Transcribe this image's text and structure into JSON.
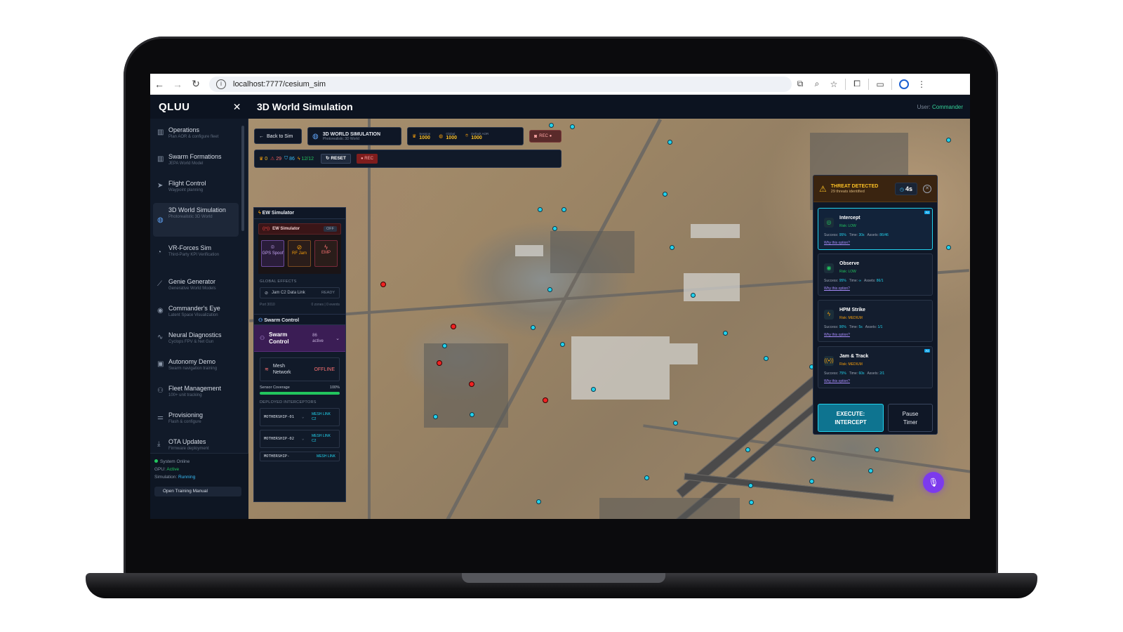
{
  "browser": {
    "url": "localhost:7777/cesium_sim"
  },
  "header": {
    "brand": "QLUU",
    "title": "3D World Simulation",
    "user_label": "User:",
    "user_name": "Commander"
  },
  "sidebar": {
    "items": [
      {
        "title": "Operations",
        "sub": "Plan AOR & configure fleet"
      },
      {
        "title": "Swarm Formations",
        "sub": "JEPA World Model"
      },
      {
        "title": "Flight Control",
        "sub": "Waypoint planning"
      },
      {
        "title": "3D World Simulation",
        "sub": "Photorealistic 3D World"
      },
      {
        "title": "VR-Forces Sim",
        "sub": "Third-Party KPI Verification"
      },
      {
        "title": "Genie Generator",
        "sub": "Generative World Models"
      },
      {
        "title": "Commander's Eye",
        "sub": "Latent Space Visualization"
      },
      {
        "title": "Neural Diagnostics",
        "sub": "Cyclops FPV & Net Gun"
      },
      {
        "title": "Autonomy Demo",
        "sub": "Swarm navigation training"
      },
      {
        "title": "Fleet Management",
        "sub": "100+ unit tracking"
      },
      {
        "title": "Provisioning",
        "sub": "Flash & configure"
      },
      {
        "title": "OTA Updates",
        "sub": "Firmware deployment"
      }
    ],
    "status": {
      "system": "System Online",
      "gpu_label": "GPU:",
      "gpu_value": "Active",
      "sim_label": "Simulation:",
      "sim_value": "Running",
      "manual": "Open Training Manual"
    }
  },
  "toolbar": {
    "back": "Back to Sim",
    "sim_title": "3D WORLD SIMULATION",
    "sim_sub": "Photorealistic 3D World",
    "session_label": "Session",
    "session_value": "1000",
    "global_label": "Global",
    "global_value": "1000",
    "aor_label": "Default AOR",
    "aor_value": "1000",
    "rec_top": "REC ●",
    "stat_trophy": "0",
    "stat_warn": "29",
    "stat_shield": "86",
    "stat_bolt": "12/12",
    "reset": "RESET",
    "rec": "● REC"
  },
  "ew": {
    "header": "EW Simulator",
    "card_label": "EW Simulator",
    "card_state": "OFF",
    "tiles": [
      "GPS Spoof",
      "RF Jam",
      "EMP"
    ],
    "global_effects": "GLOBAL EFFECTS",
    "jam_label": "Jam C2 Data Link",
    "jam_state": "READY",
    "port": "Port 3010",
    "zones": "0 zones | 0 events"
  },
  "swarm": {
    "header": "Swarm Control",
    "card_label": "Swarm Control",
    "active_count": "86",
    "active_label": "active",
    "mesh_label": "Mesh Network",
    "mesh_state": "OFFLINE",
    "coverage_label": "Sensor Coverage",
    "coverage_value": "100%",
    "coverage_fraction": 1.0,
    "interceptors_label": "DEPLOYED INTERCEPTORS",
    "interceptors": [
      {
        "name": "MOTHERSHIP-01",
        "link": "MESH LINK C2"
      },
      {
        "name": "MOTHERSHIP-02",
        "link": "MESH LINK C2"
      },
      {
        "name": "MOTHERSHIP-",
        "link": "MESH LINK"
      }
    ]
  },
  "threat": {
    "title": "THREAT DETECTED",
    "subtitle": "29 threats identified",
    "timer": "4s",
    "options": [
      {
        "name": "Intercept",
        "risk": "Risk: LOW",
        "risk_color": "#22c55e",
        "success": "95%",
        "time": "30s",
        "assets": "86/46",
        "why": "Why this option?",
        "ai": "AI",
        "icon": "target-icon",
        "glyph": "◎",
        "selected": true
      },
      {
        "name": "Observe",
        "risk": "Risk: LOW",
        "risk_color": "#22c55e",
        "success": "95%",
        "time": "∞",
        "assets": "86/1",
        "why": "Why this option?",
        "ai": "",
        "icon": "eye-icon",
        "glyph": "◉",
        "selected": false
      },
      {
        "name": "HPM Strike",
        "risk": "Risk: MEDIUM",
        "risk_color": "#f59e0b",
        "success": "90%",
        "time": "5s",
        "assets": "1/1",
        "why": "Why this option?",
        "ai": "",
        "icon": "bolt-icon",
        "glyph": "ϟ",
        "selected": false
      },
      {
        "name": "Jam & Track",
        "risk": "Risk: MEDIUM",
        "risk_color": "#f59e0b",
        "success": "75%",
        "time": "60s",
        "assets": "2/1",
        "why": "Why this option?",
        "ai": "AI",
        "icon": "radio-icon",
        "glyph": "((•))",
        "selected": false
      }
    ],
    "labels": {
      "success": "Success:",
      "time": "Time:",
      "assets": "Assets:"
    },
    "execute_line1": "EXECUTE:",
    "execute_line2": "INTERCEPT",
    "pause_line1": "Pause",
    "pause_line2": "Timer"
  },
  "map": {
    "friendly_color": "#22d3ee",
    "hostile_color": "#ef2222",
    "friendly_count_shown": 40,
    "hostile_count_shown": 7
  }
}
